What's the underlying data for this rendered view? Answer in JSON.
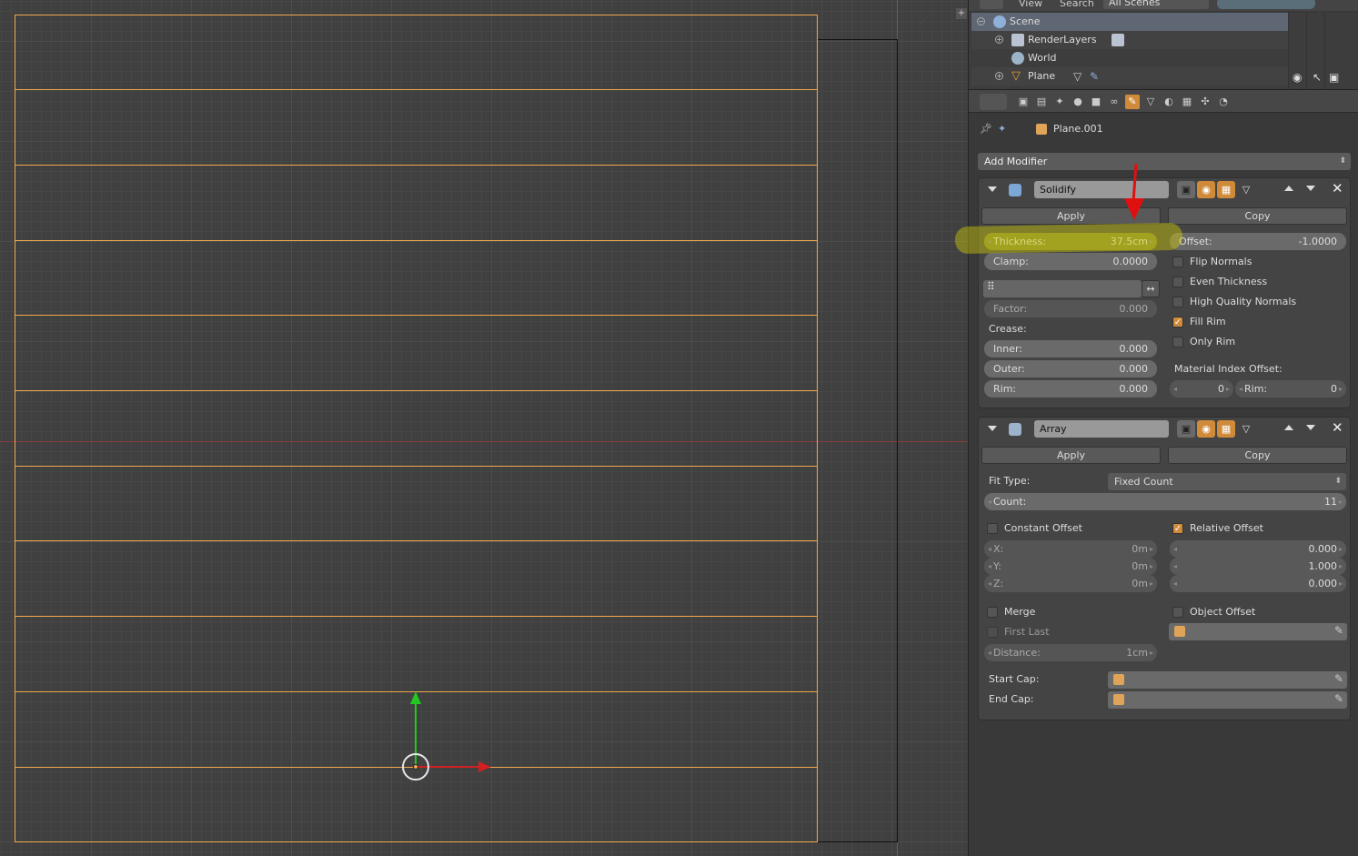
{
  "outliner": {
    "menu": {
      "view": "View",
      "search": "Search",
      "scenes": "All Scenes"
    },
    "items": [
      {
        "label": "Scene"
      },
      {
        "label": "RenderLayers"
      },
      {
        "label": "World"
      },
      {
        "label": "Plane"
      }
    ]
  },
  "context": {
    "object": "Plane.001"
  },
  "add_modifier": "Add Modifier",
  "solidify": {
    "name": "Solidify",
    "apply": "Apply",
    "copy": "Copy",
    "thickness_label": "Thickness:",
    "thickness_value": "37.5cm",
    "offset_label": "Offset:",
    "offset_value": "-1.0000",
    "clamp_label": "Clamp:",
    "clamp_value": "0.0000",
    "factor_label": "Factor:",
    "factor_value": "0.000",
    "crease_label": "Crease:",
    "inner_label": "Inner:",
    "inner_value": "0.000",
    "outer_label": "Outer:",
    "outer_value": "0.000",
    "rim_label": "Rim:",
    "rim_value": "0.000",
    "flip_normals": "Flip Normals",
    "even_thickness": "Even Thickness",
    "hq_normals": "High Quality Normals",
    "fill_rim": "Fill Rim",
    "only_rim": "Only Rim",
    "mat_index_label": "Material Index Offset:",
    "mat_value": "0",
    "mat_rim_label": "Rim:",
    "mat_rim_value": "0"
  },
  "array": {
    "name": "Array",
    "apply": "Apply",
    "copy": "Copy",
    "fit_type_label": "Fit Type:",
    "fit_type_value": "Fixed Count",
    "count_label": "Count:",
    "count_value": "11",
    "constant_offset": "Constant Offset",
    "relative_offset": "Relative Offset",
    "x_label": "X:",
    "x_value": "0m",
    "y_label": "Y:",
    "y_value": "0m",
    "z_label": "Z:",
    "z_value": "0m",
    "rel_x": "0.000",
    "rel_y": "1.000",
    "rel_z": "0.000",
    "merge": "Merge",
    "first_last": "First Last",
    "object_offset": "Object Offset",
    "distance_label": "Distance:",
    "distance_value": "1cm",
    "start_cap": "Start Cap:",
    "end_cap": "End Cap:"
  },
  "colors": {
    "accent": "#d08b3a",
    "plank_edge": "#f0a94e",
    "highlight": "#d7d200",
    "annotation": "#e01010"
  }
}
